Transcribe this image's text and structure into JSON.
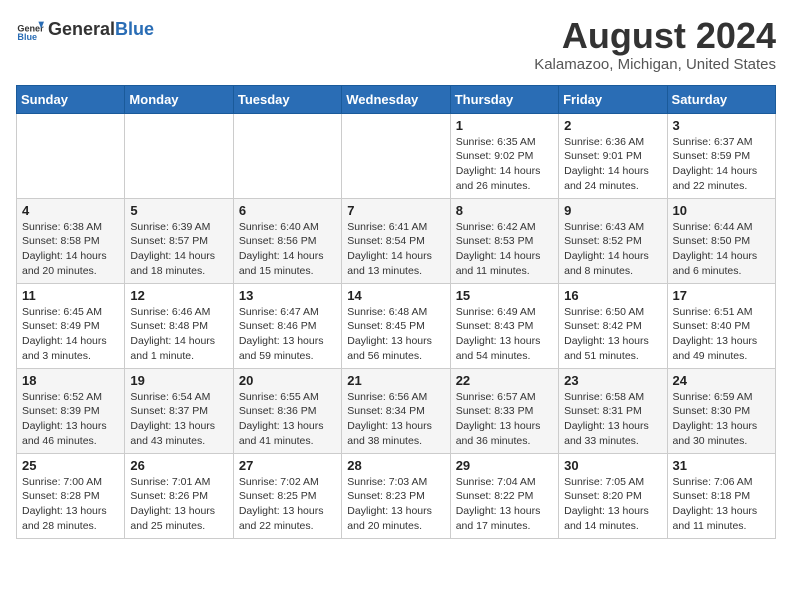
{
  "logo": {
    "general": "General",
    "blue": "Blue"
  },
  "header": {
    "title": "August 2024",
    "subtitle": "Kalamazoo, Michigan, United States"
  },
  "days_of_week": [
    "Sunday",
    "Monday",
    "Tuesday",
    "Wednesday",
    "Thursday",
    "Friday",
    "Saturday"
  ],
  "weeks": [
    [
      {
        "day": "",
        "info": ""
      },
      {
        "day": "",
        "info": ""
      },
      {
        "day": "",
        "info": ""
      },
      {
        "day": "",
        "info": ""
      },
      {
        "day": "1",
        "info": "Sunrise: 6:35 AM\nSunset: 9:02 PM\nDaylight: 14 hours and 26 minutes."
      },
      {
        "day": "2",
        "info": "Sunrise: 6:36 AM\nSunset: 9:01 PM\nDaylight: 14 hours and 24 minutes."
      },
      {
        "day": "3",
        "info": "Sunrise: 6:37 AM\nSunset: 8:59 PM\nDaylight: 14 hours and 22 minutes."
      }
    ],
    [
      {
        "day": "4",
        "info": "Sunrise: 6:38 AM\nSunset: 8:58 PM\nDaylight: 14 hours and 20 minutes."
      },
      {
        "day": "5",
        "info": "Sunrise: 6:39 AM\nSunset: 8:57 PM\nDaylight: 14 hours and 18 minutes."
      },
      {
        "day": "6",
        "info": "Sunrise: 6:40 AM\nSunset: 8:56 PM\nDaylight: 14 hours and 15 minutes."
      },
      {
        "day": "7",
        "info": "Sunrise: 6:41 AM\nSunset: 8:54 PM\nDaylight: 14 hours and 13 minutes."
      },
      {
        "day": "8",
        "info": "Sunrise: 6:42 AM\nSunset: 8:53 PM\nDaylight: 14 hours and 11 minutes."
      },
      {
        "day": "9",
        "info": "Sunrise: 6:43 AM\nSunset: 8:52 PM\nDaylight: 14 hours and 8 minutes."
      },
      {
        "day": "10",
        "info": "Sunrise: 6:44 AM\nSunset: 8:50 PM\nDaylight: 14 hours and 6 minutes."
      }
    ],
    [
      {
        "day": "11",
        "info": "Sunrise: 6:45 AM\nSunset: 8:49 PM\nDaylight: 14 hours and 3 minutes."
      },
      {
        "day": "12",
        "info": "Sunrise: 6:46 AM\nSunset: 8:48 PM\nDaylight: 14 hours and 1 minute."
      },
      {
        "day": "13",
        "info": "Sunrise: 6:47 AM\nSunset: 8:46 PM\nDaylight: 13 hours and 59 minutes."
      },
      {
        "day": "14",
        "info": "Sunrise: 6:48 AM\nSunset: 8:45 PM\nDaylight: 13 hours and 56 minutes."
      },
      {
        "day": "15",
        "info": "Sunrise: 6:49 AM\nSunset: 8:43 PM\nDaylight: 13 hours and 54 minutes."
      },
      {
        "day": "16",
        "info": "Sunrise: 6:50 AM\nSunset: 8:42 PM\nDaylight: 13 hours and 51 minutes."
      },
      {
        "day": "17",
        "info": "Sunrise: 6:51 AM\nSunset: 8:40 PM\nDaylight: 13 hours and 49 minutes."
      }
    ],
    [
      {
        "day": "18",
        "info": "Sunrise: 6:52 AM\nSunset: 8:39 PM\nDaylight: 13 hours and 46 minutes."
      },
      {
        "day": "19",
        "info": "Sunrise: 6:54 AM\nSunset: 8:37 PM\nDaylight: 13 hours and 43 minutes."
      },
      {
        "day": "20",
        "info": "Sunrise: 6:55 AM\nSunset: 8:36 PM\nDaylight: 13 hours and 41 minutes."
      },
      {
        "day": "21",
        "info": "Sunrise: 6:56 AM\nSunset: 8:34 PM\nDaylight: 13 hours and 38 minutes."
      },
      {
        "day": "22",
        "info": "Sunrise: 6:57 AM\nSunset: 8:33 PM\nDaylight: 13 hours and 36 minutes."
      },
      {
        "day": "23",
        "info": "Sunrise: 6:58 AM\nSunset: 8:31 PM\nDaylight: 13 hours and 33 minutes."
      },
      {
        "day": "24",
        "info": "Sunrise: 6:59 AM\nSunset: 8:30 PM\nDaylight: 13 hours and 30 minutes."
      }
    ],
    [
      {
        "day": "25",
        "info": "Sunrise: 7:00 AM\nSunset: 8:28 PM\nDaylight: 13 hours and 28 minutes."
      },
      {
        "day": "26",
        "info": "Sunrise: 7:01 AM\nSunset: 8:26 PM\nDaylight: 13 hours and 25 minutes."
      },
      {
        "day": "27",
        "info": "Sunrise: 7:02 AM\nSunset: 8:25 PM\nDaylight: 13 hours and 22 minutes."
      },
      {
        "day": "28",
        "info": "Sunrise: 7:03 AM\nSunset: 8:23 PM\nDaylight: 13 hours and 20 minutes."
      },
      {
        "day": "29",
        "info": "Sunrise: 7:04 AM\nSunset: 8:22 PM\nDaylight: 13 hours and 17 minutes."
      },
      {
        "day": "30",
        "info": "Sunrise: 7:05 AM\nSunset: 8:20 PM\nDaylight: 13 hours and 14 minutes."
      },
      {
        "day": "31",
        "info": "Sunrise: 7:06 AM\nSunset: 8:18 PM\nDaylight: 13 hours and 11 minutes."
      }
    ]
  ]
}
